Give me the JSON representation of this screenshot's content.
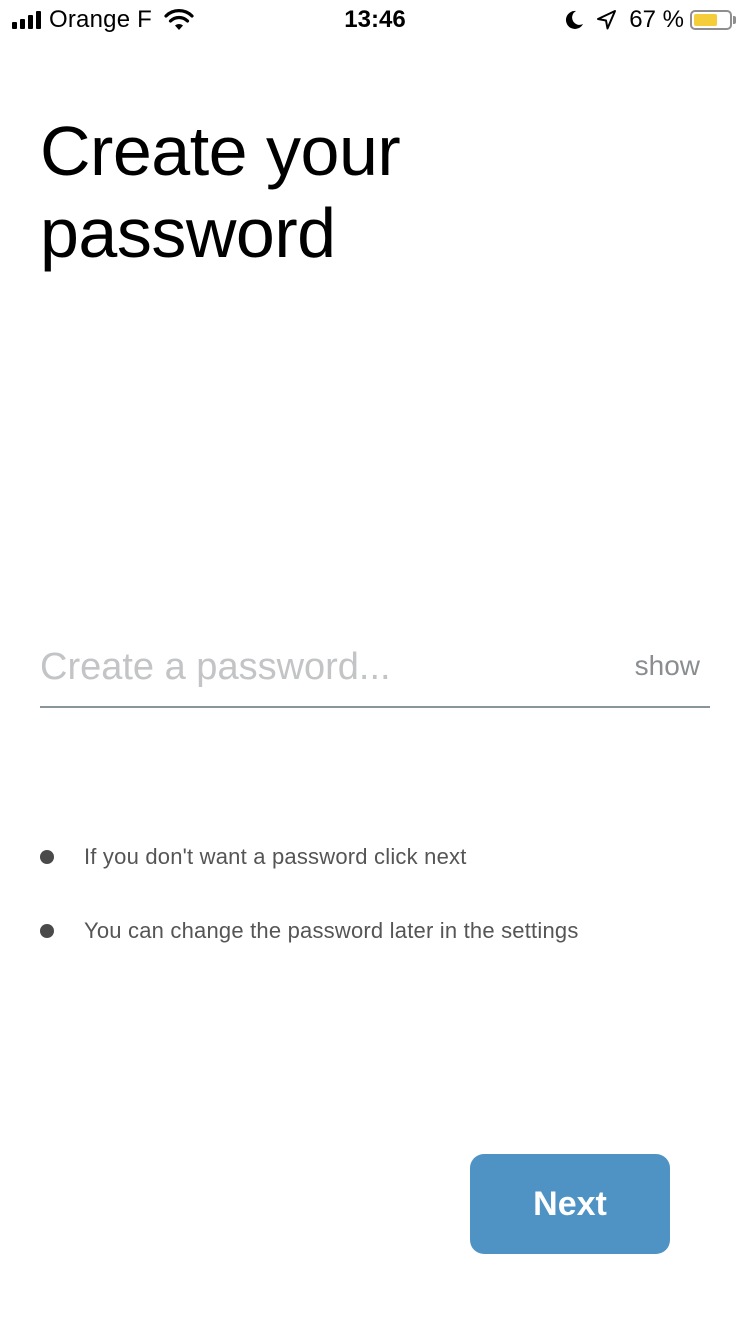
{
  "status_bar": {
    "carrier": "Orange F",
    "time": "13:46",
    "battery_percent": "67 %",
    "battery_level": 0.67,
    "icons": [
      "signal-bars-icon",
      "wifi-icon",
      "moon-icon",
      "location-arrow-icon",
      "battery-icon"
    ],
    "battery_color": "#f5cc3a"
  },
  "title": {
    "line1": "Create your",
    "line2": "password"
  },
  "password": {
    "placeholder": "Create a password...",
    "value": "",
    "show_label": "show"
  },
  "hints": [
    {
      "text": "If you don't want a password click next"
    },
    {
      "text": "You can change the password later in the settings"
    }
  ],
  "next_button": {
    "label": "Next",
    "color": "#4f93c5"
  }
}
